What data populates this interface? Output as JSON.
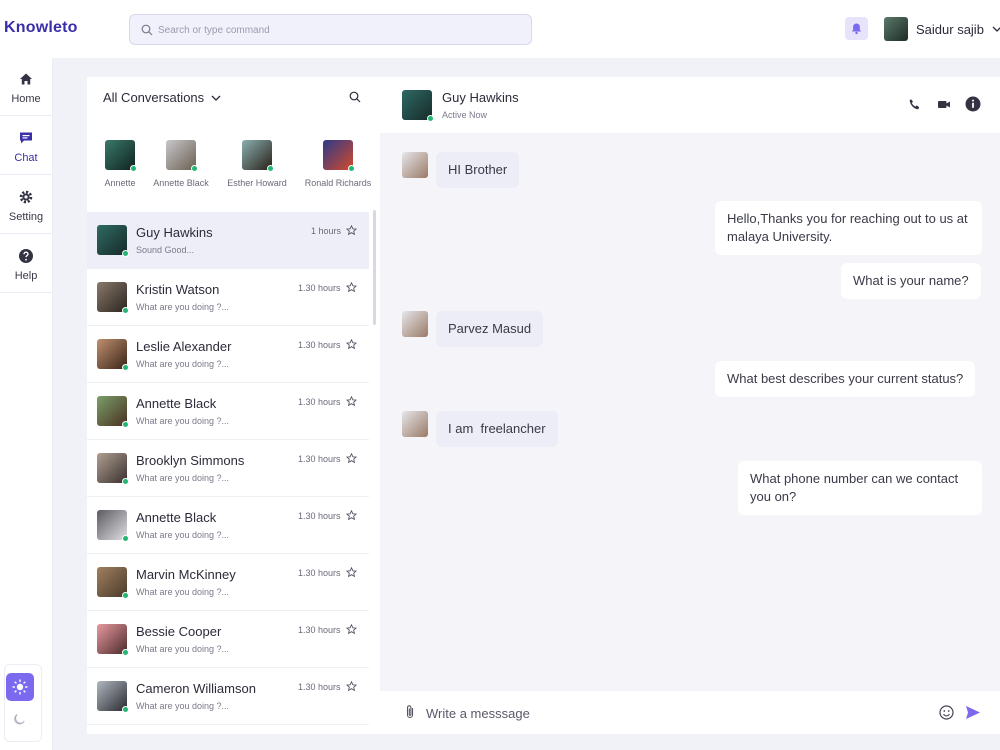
{
  "app": {
    "brand": "Knowleto"
  },
  "search": {
    "placeholder": "Search or type command"
  },
  "user": {
    "name": "Saidur sajib"
  },
  "nav": [
    {
      "label": "Home",
      "icon": "home-icon"
    },
    {
      "label": "Chat",
      "icon": "chat-icon"
    },
    {
      "label": "Setting",
      "icon": "gear-icon"
    },
    {
      "label": "Help",
      "icon": "help-icon"
    }
  ],
  "conversations": {
    "header": "All Conversations",
    "stories": [
      {
        "name": "Annette"
      },
      {
        "name": "Annette Black"
      },
      {
        "name": "Esther Howard"
      },
      {
        "name": "Ronald Richards"
      }
    ],
    "list": [
      {
        "name": "Guy Hawkins",
        "message": "Sound Good...",
        "time": "1 hours"
      },
      {
        "name": "Kristin Watson",
        "message": "What are you doing ?...",
        "time": "1.30 hours"
      },
      {
        "name": "Leslie Alexander",
        "message": "What are you doing ?...",
        "time": "1.30 hours"
      },
      {
        "name": "Annette Black",
        "message": "What are you doing ?...",
        "time": "1.30 hours"
      },
      {
        "name": "Brooklyn Simmons",
        "message": "What are you doing ?...",
        "time": "1.30 hours"
      },
      {
        "name": "Annette Black",
        "message": "What are you doing ?...",
        "time": "1.30 hours"
      },
      {
        "name": "Marvin McKinney",
        "message": "What are you doing ?...",
        "time": "1.30 hours"
      },
      {
        "name": "Bessie Cooper",
        "message": "What are you doing ?...",
        "time": "1.30 hours"
      },
      {
        "name": "Cameron Williamson",
        "message": "What are you doing ?...",
        "time": "1.30 hours"
      }
    ]
  },
  "chat": {
    "contact_name": "Guy Hawkins",
    "contact_status": "Active Now",
    "messages": [
      {
        "dir": "in",
        "text": "HI Brother"
      },
      {
        "dir": "out",
        "text": "Hello,Thanks you for reaching out to us at malaya University."
      },
      {
        "dir": "out",
        "text": "What is your name?"
      },
      {
        "dir": "in",
        "text": "Parvez Masud"
      },
      {
        "dir": "out",
        "text": "What best describes your current status?"
      },
      {
        "dir": "in",
        "text": "I am  freelancher"
      },
      {
        "dir": "out",
        "text": "What phone number can we contact you on?"
      }
    ],
    "composer_placeholder": "Write a messsage"
  },
  "colors": {
    "accent": "#3b2fa8",
    "theme_toggle": "#7b6af0",
    "online": "#22b573",
    "send": "#7b6af0"
  }
}
